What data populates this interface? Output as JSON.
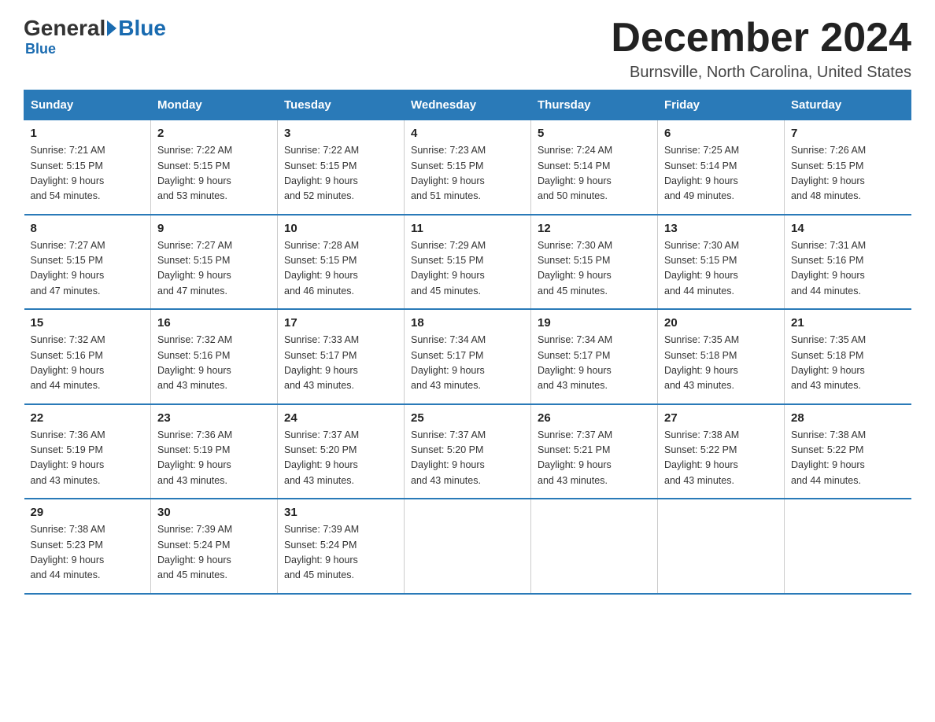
{
  "header": {
    "logo_general": "General",
    "logo_blue": "Blue",
    "month_title": "December 2024",
    "location": "Burnsville, North Carolina, United States"
  },
  "days_of_week": [
    "Sunday",
    "Monday",
    "Tuesday",
    "Wednesday",
    "Thursday",
    "Friday",
    "Saturday"
  ],
  "weeks": [
    [
      {
        "day": "1",
        "sunrise": "7:21 AM",
        "sunset": "5:15 PM",
        "daylight": "9 hours and 54 minutes."
      },
      {
        "day": "2",
        "sunrise": "7:22 AM",
        "sunset": "5:15 PM",
        "daylight": "9 hours and 53 minutes."
      },
      {
        "day": "3",
        "sunrise": "7:22 AM",
        "sunset": "5:15 PM",
        "daylight": "9 hours and 52 minutes."
      },
      {
        "day": "4",
        "sunrise": "7:23 AM",
        "sunset": "5:15 PM",
        "daylight": "9 hours and 51 minutes."
      },
      {
        "day": "5",
        "sunrise": "7:24 AM",
        "sunset": "5:14 PM",
        "daylight": "9 hours and 50 minutes."
      },
      {
        "day": "6",
        "sunrise": "7:25 AM",
        "sunset": "5:14 PM",
        "daylight": "9 hours and 49 minutes."
      },
      {
        "day": "7",
        "sunrise": "7:26 AM",
        "sunset": "5:15 PM",
        "daylight": "9 hours and 48 minutes."
      }
    ],
    [
      {
        "day": "8",
        "sunrise": "7:27 AM",
        "sunset": "5:15 PM",
        "daylight": "9 hours and 47 minutes."
      },
      {
        "day": "9",
        "sunrise": "7:27 AM",
        "sunset": "5:15 PM",
        "daylight": "9 hours and 47 minutes."
      },
      {
        "day": "10",
        "sunrise": "7:28 AM",
        "sunset": "5:15 PM",
        "daylight": "9 hours and 46 minutes."
      },
      {
        "day": "11",
        "sunrise": "7:29 AM",
        "sunset": "5:15 PM",
        "daylight": "9 hours and 45 minutes."
      },
      {
        "day": "12",
        "sunrise": "7:30 AM",
        "sunset": "5:15 PM",
        "daylight": "9 hours and 45 minutes."
      },
      {
        "day": "13",
        "sunrise": "7:30 AM",
        "sunset": "5:15 PM",
        "daylight": "9 hours and 44 minutes."
      },
      {
        "day": "14",
        "sunrise": "7:31 AM",
        "sunset": "5:16 PM",
        "daylight": "9 hours and 44 minutes."
      }
    ],
    [
      {
        "day": "15",
        "sunrise": "7:32 AM",
        "sunset": "5:16 PM",
        "daylight": "9 hours and 44 minutes."
      },
      {
        "day": "16",
        "sunrise": "7:32 AM",
        "sunset": "5:16 PM",
        "daylight": "9 hours and 43 minutes."
      },
      {
        "day": "17",
        "sunrise": "7:33 AM",
        "sunset": "5:17 PM",
        "daylight": "9 hours and 43 minutes."
      },
      {
        "day": "18",
        "sunrise": "7:34 AM",
        "sunset": "5:17 PM",
        "daylight": "9 hours and 43 minutes."
      },
      {
        "day": "19",
        "sunrise": "7:34 AM",
        "sunset": "5:17 PM",
        "daylight": "9 hours and 43 minutes."
      },
      {
        "day": "20",
        "sunrise": "7:35 AM",
        "sunset": "5:18 PM",
        "daylight": "9 hours and 43 minutes."
      },
      {
        "day": "21",
        "sunrise": "7:35 AM",
        "sunset": "5:18 PM",
        "daylight": "9 hours and 43 minutes."
      }
    ],
    [
      {
        "day": "22",
        "sunrise": "7:36 AM",
        "sunset": "5:19 PM",
        "daylight": "9 hours and 43 minutes."
      },
      {
        "day": "23",
        "sunrise": "7:36 AM",
        "sunset": "5:19 PM",
        "daylight": "9 hours and 43 minutes."
      },
      {
        "day": "24",
        "sunrise": "7:37 AM",
        "sunset": "5:20 PM",
        "daylight": "9 hours and 43 minutes."
      },
      {
        "day": "25",
        "sunrise": "7:37 AM",
        "sunset": "5:20 PM",
        "daylight": "9 hours and 43 minutes."
      },
      {
        "day": "26",
        "sunrise": "7:37 AM",
        "sunset": "5:21 PM",
        "daylight": "9 hours and 43 minutes."
      },
      {
        "day": "27",
        "sunrise": "7:38 AM",
        "sunset": "5:22 PM",
        "daylight": "9 hours and 43 minutes."
      },
      {
        "day": "28",
        "sunrise": "7:38 AM",
        "sunset": "5:22 PM",
        "daylight": "9 hours and 44 minutes."
      }
    ],
    [
      {
        "day": "29",
        "sunrise": "7:38 AM",
        "sunset": "5:23 PM",
        "daylight": "9 hours and 44 minutes."
      },
      {
        "day": "30",
        "sunrise": "7:39 AM",
        "sunset": "5:24 PM",
        "daylight": "9 hours and 45 minutes."
      },
      {
        "day": "31",
        "sunrise": "7:39 AM",
        "sunset": "5:24 PM",
        "daylight": "9 hours and 45 minutes."
      },
      null,
      null,
      null,
      null
    ]
  ],
  "labels": {
    "sunrise": "Sunrise:",
    "sunset": "Sunset:",
    "daylight": "Daylight:"
  }
}
